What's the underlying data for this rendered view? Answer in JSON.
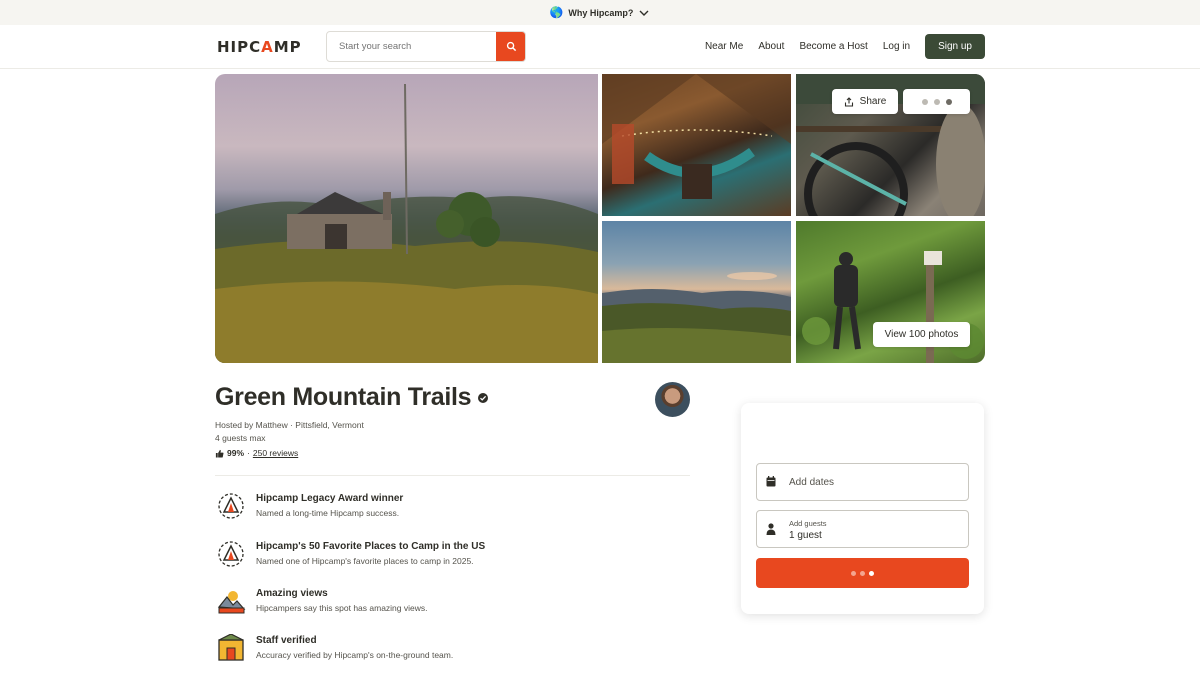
{
  "promo": {
    "globe": "🌎",
    "text": "Why Hipcamp?",
    "icon": "chevron-down-icon"
  },
  "header": {
    "logo_pre": "HIPC",
    "logo_accent": "A",
    "logo_post": "MP",
    "search_placeholder": "Start your search",
    "nav": [
      "Near Me",
      "About",
      "Become a Host",
      "Log in"
    ],
    "signup": "Sign up"
  },
  "gallery": {
    "share": "Share",
    "view_photos": "View 100 photos",
    "photos": [
      "stone-cabin-meadow-photo",
      "hammock-cabin-interior-photo",
      "bike-stone-wall-photo",
      "mountain-sunset-photo",
      "hiker-trail-photo"
    ]
  },
  "listing": {
    "title": "Green Mountain Trails",
    "hosted": "Hosted by Matthew · Pittsfield, Vermont",
    "guests": "4 guests max",
    "rating_pct": "99%",
    "rating_sep": "·",
    "reviews": "250 reviews"
  },
  "features": [
    {
      "title": "Hipcamp Legacy Award winner",
      "desc": "Named a long-time Hipcamp success.",
      "icon": "legacy-award-icon"
    },
    {
      "title": "Hipcamp's 50 Favorite Places to Camp in the US",
      "desc": "Named one of Hipcamp's favorite places to camp in 2025.",
      "icon": "favorite-places-icon"
    },
    {
      "title": "Amazing views",
      "desc": "Hipcampers say this spot has amazing views.",
      "icon": "amazing-views-icon"
    },
    {
      "title": "Staff verified",
      "desc": "Accuracy verified by Hipcamp's on-the-ground team.",
      "icon": "staff-verified-icon"
    }
  ],
  "booking": {
    "dates_label": "Add dates",
    "guests_label": "Add guests",
    "guests_value": "1 guest"
  },
  "colors": {
    "accent": "#e8481f",
    "signup_bg": "#3b4a36",
    "text": "#2f2e28"
  }
}
